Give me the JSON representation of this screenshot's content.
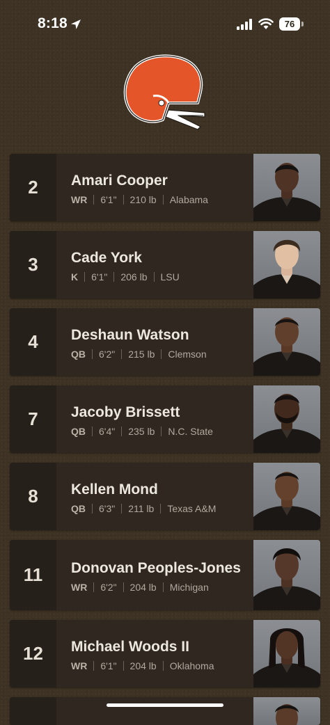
{
  "status_bar": {
    "time": "8:18",
    "battery": "76"
  },
  "theme": {
    "background": "#3d3223",
    "card": "#302820",
    "number_cell": "#26201a",
    "helmet_orange": "#e4552a"
  },
  "logo": {
    "icon": "helmet-icon"
  },
  "players": [
    {
      "number": "2",
      "name": "Amari Cooper",
      "position": "WR",
      "height": "6'1\"",
      "weight": "210 lb",
      "college": "Alabama"
    },
    {
      "number": "3",
      "name": "Cade York",
      "position": "K",
      "height": "6'1\"",
      "weight": "206 lb",
      "college": "LSU"
    },
    {
      "number": "4",
      "name": "Deshaun Watson",
      "position": "QB",
      "height": "6'2\"",
      "weight": "215 lb",
      "college": "Clemson"
    },
    {
      "number": "7",
      "name": "Jacoby Brissett",
      "position": "QB",
      "height": "6'4\"",
      "weight": "235 lb",
      "college": "N.C. State"
    },
    {
      "number": "8",
      "name": "Kellen Mond",
      "position": "QB",
      "height": "6'3\"",
      "weight": "211 lb",
      "college": "Texas A&M"
    },
    {
      "number": "11",
      "name": "Donovan Peoples-Jones",
      "position": "WR",
      "height": "6'2\"",
      "weight": "204 lb",
      "college": "Michigan"
    },
    {
      "number": "12",
      "name": "Michael Woods II",
      "position": "WR",
      "height": "6'1\"",
      "weight": "204 lb",
      "college": "Oklahoma"
    }
  ]
}
